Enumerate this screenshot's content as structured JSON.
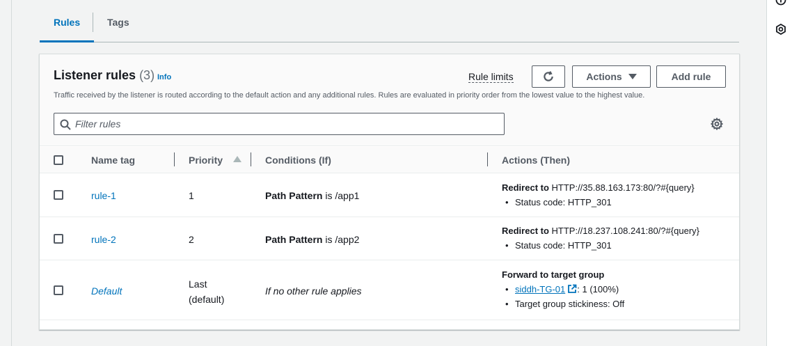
{
  "tabs": [
    {
      "label": "Rules",
      "active": true
    },
    {
      "label": "Tags",
      "active": false
    }
  ],
  "panel": {
    "title": "Listener rules",
    "count": "(3)",
    "info": "Info",
    "description": "Traffic received by the listener is routed according to the default action and any additional rules. Rules are evaluated in priority order from the lowest value to the highest value.",
    "rule_limits": "Rule limits",
    "actions_label": "Actions",
    "add_rule_label": "Add rule",
    "filter_placeholder": "Filter rules",
    "filter_value": ""
  },
  "table": {
    "columns": [
      "Name tag",
      "Priority",
      "Conditions (If)",
      "Actions (Then)"
    ],
    "sorted_column": "Priority",
    "sort_direction": "ascending",
    "rows": [
      {
        "name": "rule-1",
        "priority": "1",
        "condition_key": "Path Pattern",
        "condition_rest": " is /app1",
        "action_title": "Redirect to",
        "action_target": " HTTP://35.88.163.173:80/?#{query}",
        "action_detail": "Status code: HTTP_301"
      },
      {
        "name": "rule-2",
        "priority": "2",
        "condition_key": "Path Pattern",
        "condition_rest": " is /app2",
        "action_title": "Redirect to",
        "action_target": " HTTP://18.237.108.241:80/?#{query}",
        "action_detail": "Status code: HTTP_301"
      },
      {
        "name": "Default",
        "priority_line1": "Last",
        "priority_line2": "(default)",
        "condition": "If no other rule applies",
        "action_title": "Forward to target group",
        "target_group": "siddh-TG-01",
        "target_weight": ": 1 (100%)",
        "stickiness": "Target group stickiness: Off"
      }
    ]
  },
  "icons": {
    "refresh": "refresh-icon",
    "search": "search-icon",
    "settings": "gear-icon",
    "external": "external-link-icon",
    "rail_info": "info-icon",
    "rail_hex": "hexagon-icon"
  },
  "colors": {
    "link": "#0073bb",
    "text": "#16191f",
    "muted": "#545b64",
    "border": "#d5dbdb"
  }
}
